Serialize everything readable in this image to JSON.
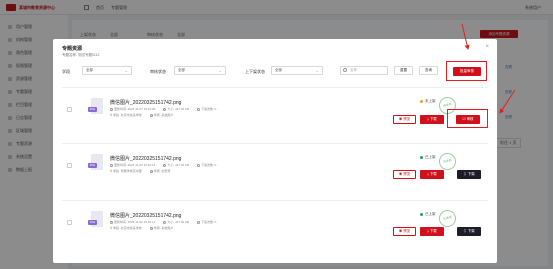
{
  "app": {
    "logo_text": "某城市教育资源中心",
    "top_menu": [
      "首页",
      "专题管理"
    ],
    "user": "系统用户"
  },
  "sidebar": {
    "items": [
      "用户管理",
      "机构管理",
      "角色管理",
      "权限管理",
      "资源管理",
      "专题管理",
      "栏目管理",
      "日志管理",
      "区域管理",
      "专题资源",
      "系统设置",
      "数据上报"
    ]
  },
  "background": {
    "filter_label_1": "上架状态",
    "filter_value_1": "全部",
    "filter_label_2": "审核状态",
    "filter_value_2": "全部",
    "add_button": "添加专题资源",
    "cells": [
      "查看",
      "查看",
      "查看"
    ],
    "pagination": "前往 1 页"
  },
  "modal": {
    "title": "专题资源",
    "close": "×",
    "subtitle": "专题名称: 测试专题0112",
    "filters": [
      {
        "label": "学段",
        "value": "全部"
      },
      {
        "label": "审核状态",
        "value": "全部"
      },
      {
        "label": "上下架状态",
        "value": "全部"
      }
    ],
    "search_placeholder": "名称",
    "reset_button": "重置",
    "query_button": "查询",
    "batch_review_button": "批量审核",
    "rows": [
      {
        "file_name": "微信图片_20220325151742.png",
        "update_time": "更新时间: 2022-11-07 15:14:00",
        "size": "大小: 447.92 KB",
        "downloads": "下载次数: 0",
        "uploader": "学段: 北京市某某学校",
        "author": "作者: 系统用户",
        "status": "未上架",
        "status_color": "#f0a020",
        "stamp": "待审核",
        "preview_button": "预览",
        "download_button": "下载",
        "action_button": "审核",
        "action_style": "red"
      },
      {
        "file_name": "微信图片_20220325151742.png",
        "update_time": "更新时间: 2022-11-02 15:40:14",
        "size": "大小: 447.92 KB",
        "downloads": "下载次数: 0",
        "uploader": "学段: 附属学校高中部",
        "author": "作者: 刘老师",
        "status": "已上架",
        "status_color": "#22a06b",
        "stamp": "已审核",
        "preview_button": "预览",
        "download_button": "下载",
        "action_button": "下架",
        "action_style": "dark"
      },
      {
        "file_name": "微信图片_20220325151742.png",
        "update_time": "更新时间: 2022-11-02 15:40:17",
        "size": "大小: 447.92 KB",
        "downloads": "下载次数: 0",
        "uploader": "学段: 北京市某某学校",
        "author": "作者: 系统用户",
        "status": "已上架",
        "status_color": "#22a06b",
        "stamp": "已审核",
        "preview_button": "预览",
        "download_button": "下载",
        "action_button": "下架",
        "action_style": "dark"
      }
    ]
  }
}
